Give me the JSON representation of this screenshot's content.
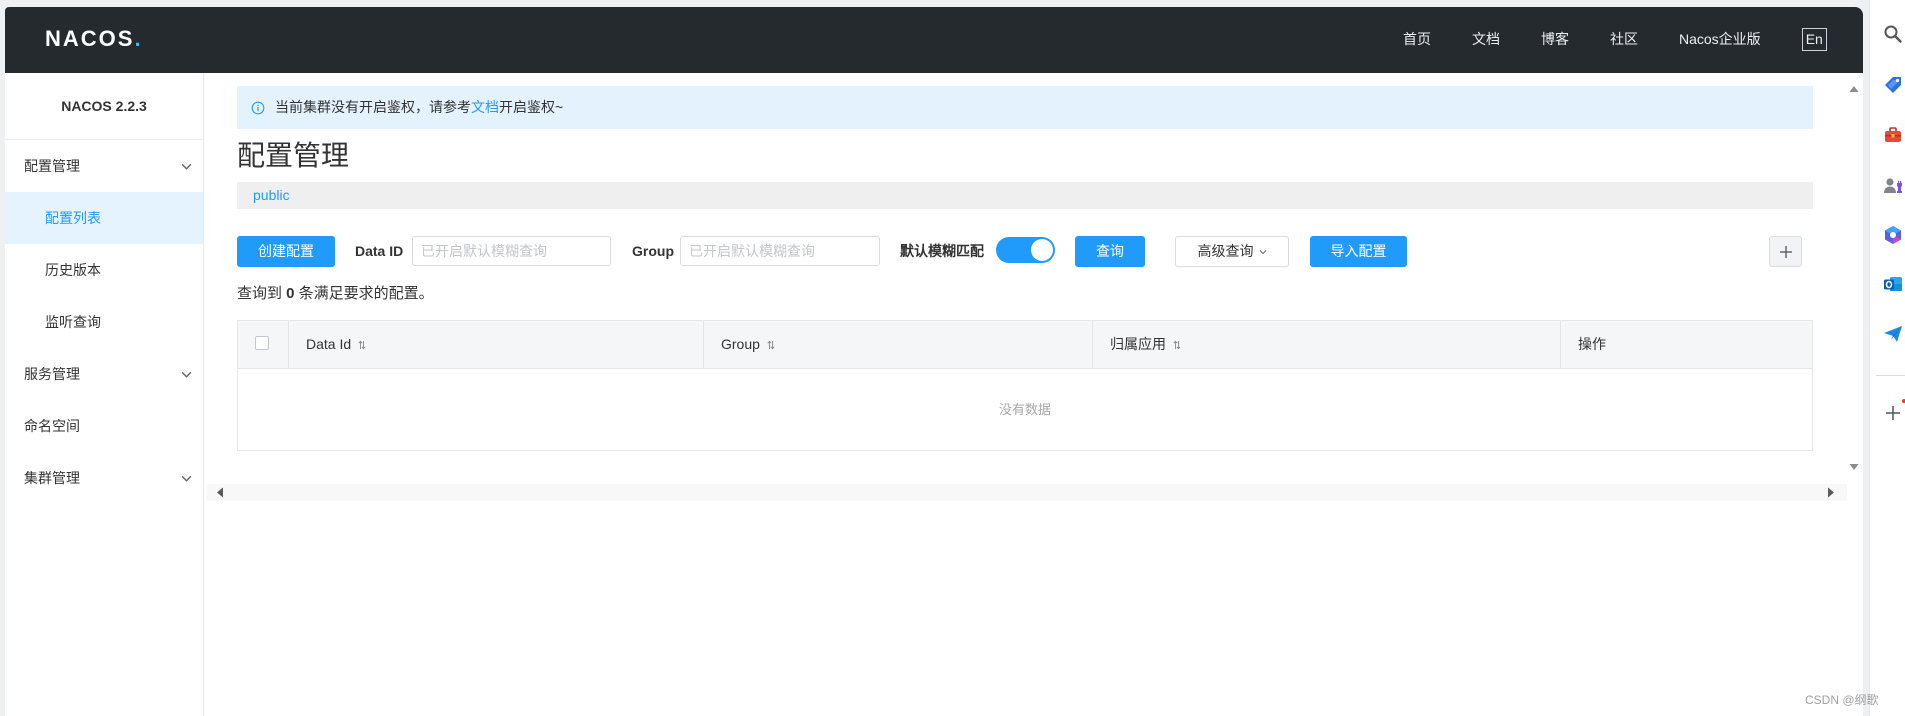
{
  "colors": {
    "accent": "#209bfa",
    "header_bg": "#252a2f",
    "notice_bg": "#e3f2fd",
    "sidebar_active_bg": "#e4f3fe"
  },
  "header": {
    "logo_text": "NACOS",
    "logo_dot": ".",
    "nav": [
      {
        "label": "首页"
      },
      {
        "label": "文档"
      },
      {
        "label": "博客"
      },
      {
        "label": "社区"
      },
      {
        "label": "Nacos企业版"
      }
    ],
    "language_toggle": "En"
  },
  "sidebar": {
    "version": "NACOS 2.2.3",
    "items": [
      {
        "label": "配置管理",
        "expandable": true,
        "icon": "chevron-down-icon"
      },
      {
        "label": "配置列表",
        "active": true
      },
      {
        "label": "历史版本"
      },
      {
        "label": "监听查询"
      },
      {
        "label": "服务管理",
        "expandable": true,
        "icon": "chevron-down-icon"
      },
      {
        "label": "命名空间"
      },
      {
        "label": "集群管理",
        "expandable": true,
        "icon": "chevron-down-icon"
      }
    ]
  },
  "notice": {
    "icon": "info-icon",
    "text_before": "当前集群没有开启鉴权，请参考",
    "link_text": "文档",
    "text_after": "开启鉴权~"
  },
  "page": {
    "title": "配置管理",
    "namespace": "public"
  },
  "toolbar": {
    "create_button": "创建配置",
    "data_id_label": "Data ID",
    "data_id_value": "",
    "data_id_placeholder": "已开启默认模糊查询",
    "group_label": "Group",
    "group_value": "",
    "group_placeholder": "已开启默认模糊查询",
    "fuzzy_match_label": "默认模糊匹配",
    "fuzzy_match_enabled": true,
    "query_button": "查询",
    "advanced_query_button": "高级查询",
    "import_button": "导入配置",
    "add_icon": "plus-icon"
  },
  "results": {
    "prefix": "查询到 ",
    "count": "0",
    "suffix": " 条满足要求的配置。"
  },
  "table": {
    "select_all_checked": false,
    "columns": [
      {
        "label": "Data Id",
        "sortable": true
      },
      {
        "label": "Group",
        "sortable": true
      },
      {
        "label": "归属应用",
        "sortable": true
      },
      {
        "label": "操作",
        "sortable": false
      }
    ],
    "rows": [],
    "empty_text": "没有数据"
  },
  "browser_sidebar": {
    "icons": [
      "search-icon",
      "tag-icon",
      "toolbox-icon",
      "games-icon",
      "copilot-icon",
      "outlook-icon",
      "send-icon",
      "add-icon"
    ]
  },
  "watermark": "CSDN @纲歌"
}
